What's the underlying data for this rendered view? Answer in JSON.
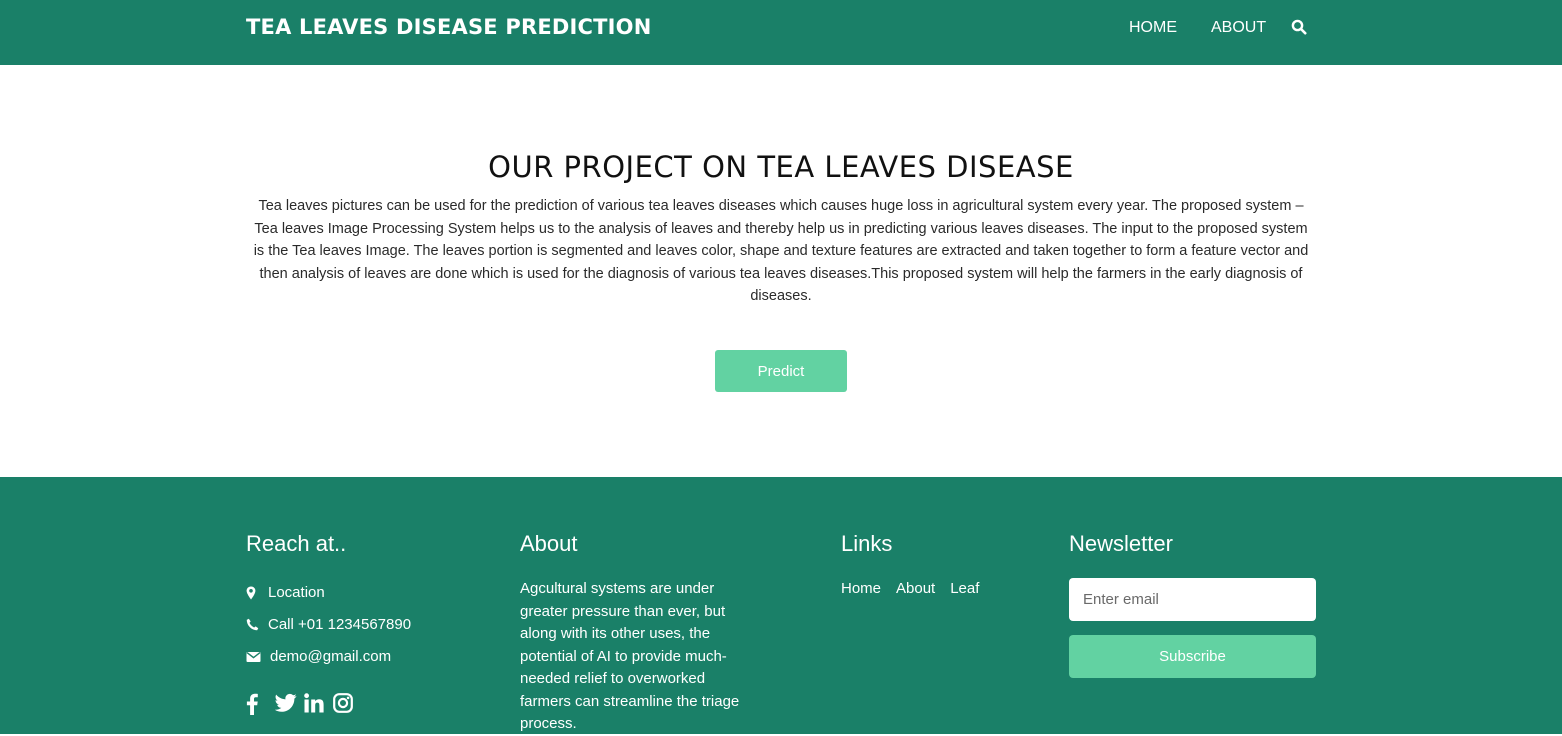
{
  "header": {
    "brand": "TEA LEAVES DISEASE PREDICTION",
    "nav": {
      "home": "HOME",
      "about": "ABOUT"
    },
    "search_icon": "search-icon"
  },
  "hero": {
    "title": "OUR PROJECT ON TEA LEAVES DISEASE",
    "text": "Tea leaves pictures can be used for the prediction of various tea leaves diseases which causes huge loss in agricultural system every year. The proposed system – Tea leaves Image Processing System helps us to the analysis of leaves and thereby help us in predicting various leaves diseases. The input to the proposed system is the Tea leaves Image. The leaves portion is segmented and leaves color, shape and texture features are extracted and taken together to form a feature vector and then analysis of leaves are done which is used for the diagnosis of various tea leaves diseases.This proposed system will help the farmers in the early diagnosis of diseases.",
    "predict_label": "Predict"
  },
  "footer": {
    "reach": {
      "title": "Reach at..",
      "location": "Location",
      "call": "Call +01 1234567890",
      "email": "demo@gmail.com",
      "social_icons": [
        "facebook-icon",
        "twitter-icon",
        "linkedin-icon",
        "instagram-icon"
      ]
    },
    "about": {
      "title": "About",
      "text": "Agcultural systems are under greater pressure than ever, but along with its other uses, the potential of AI to provide much-needed relief to overworked farmers can streamline the triage process."
    },
    "links": {
      "title": "Links",
      "items": [
        "Home",
        "About",
        "Leaf"
      ]
    },
    "newsletter": {
      "title": "Newsletter",
      "placeholder": "Enter email",
      "subscribe_label": "Subscribe"
    }
  },
  "colors": {
    "primary": "#1a8068",
    "accent": "#62d2a2",
    "background": "#ffffff"
  }
}
